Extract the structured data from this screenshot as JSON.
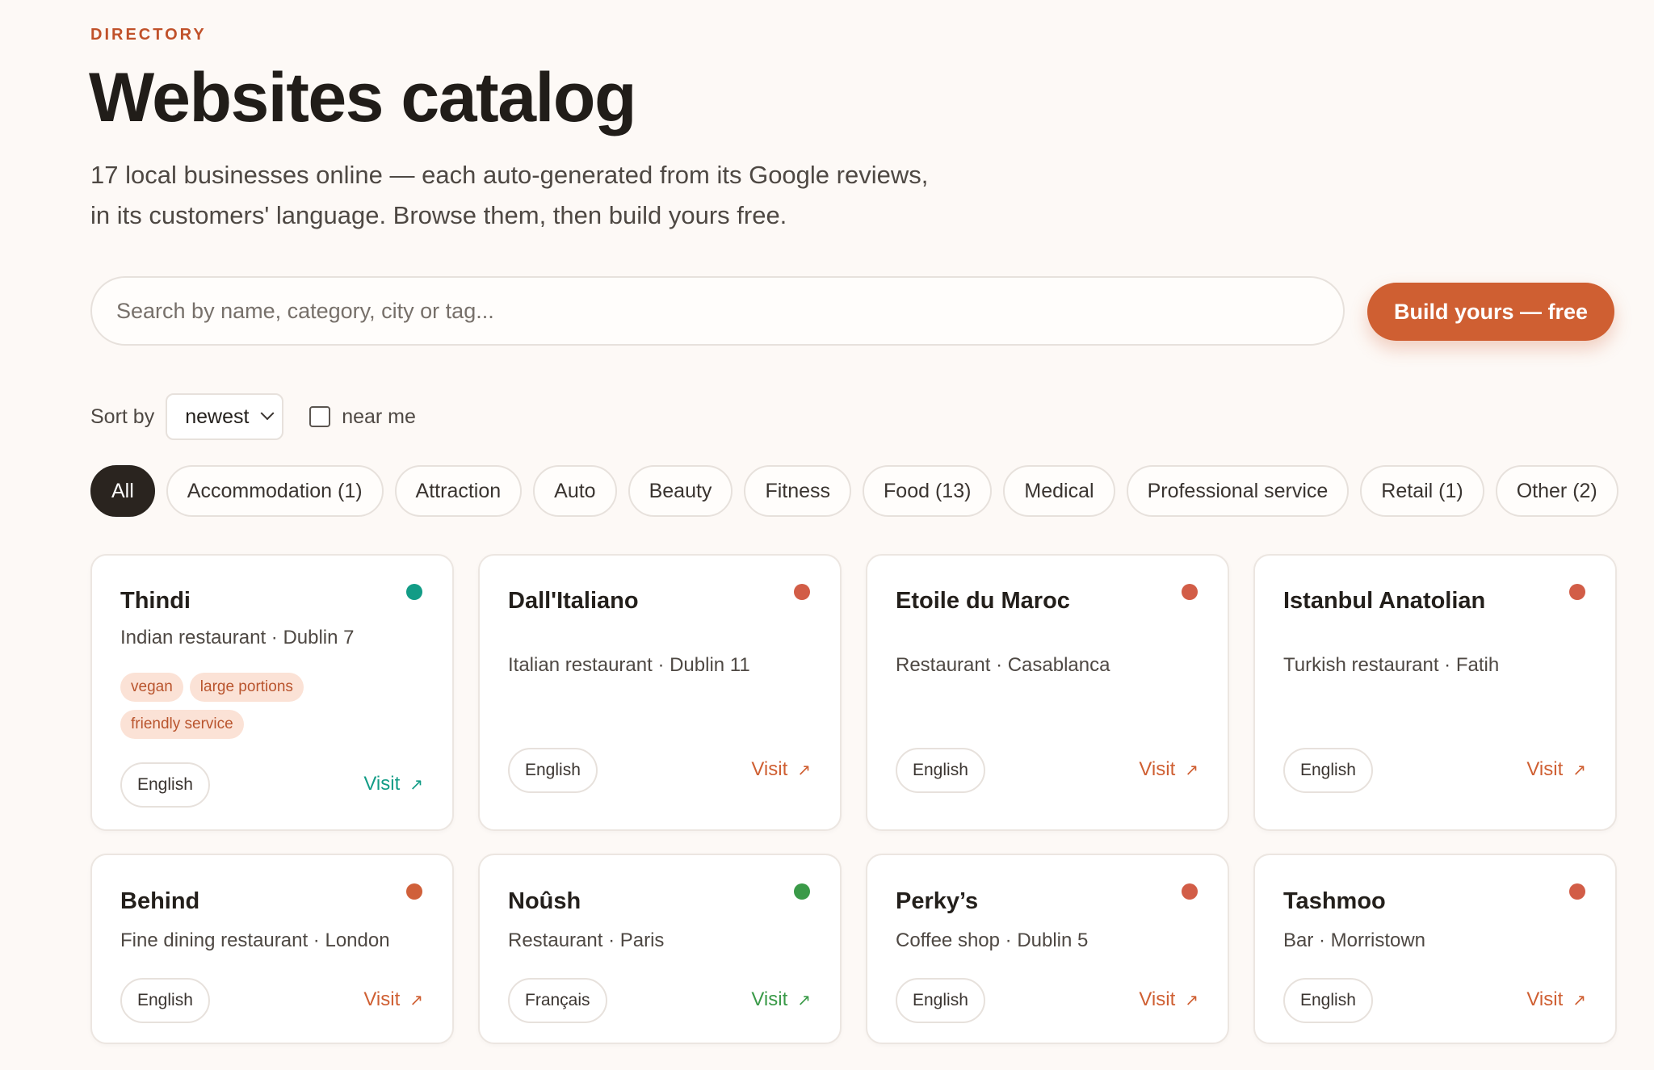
{
  "header": {
    "eyebrow": "DIRECTORY",
    "title": "Websites catalog",
    "subtitle_line1": "17 local businesses online — each auto-generated from its Google reviews,",
    "subtitle_line2": "in its customers' language. Browse them, then build yours free."
  },
  "search": {
    "placeholder": "Search by name, category, city or tag...",
    "value": ""
  },
  "cta": {
    "label": "Build yours — free",
    "color": "#cf5f32"
  },
  "sort": {
    "label": "Sort by",
    "selected": "newest",
    "near_me_label": "near me",
    "near_me_checked": false
  },
  "filters": [
    {
      "label": "All",
      "active": true
    },
    {
      "label": "Accommodation (1)"
    },
    {
      "label": "Attraction"
    },
    {
      "label": "Auto"
    },
    {
      "label": "Beauty"
    },
    {
      "label": "Fitness"
    },
    {
      "label": "Food (13)"
    },
    {
      "label": "Medical"
    },
    {
      "label": "Professional service"
    },
    {
      "label": "Retail (1)"
    },
    {
      "label": "Other (2)"
    }
  ],
  "colors": {
    "accent_orange": "#cf5f32",
    "teal": "#129c86",
    "green": "#3a9a48",
    "red": "#d25d47"
  },
  "cards": [
    {
      "name": "Thindi",
      "meta": "Indian restaurant · Dublin 7",
      "tags": [
        "vegan",
        "large portions",
        "friendly service"
      ],
      "language": "English",
      "visit": "Visit",
      "status_color": "#129c86"
    },
    {
      "name": "Dall'Italiano",
      "meta": "Italian restaurant · Dublin 11",
      "tags": [],
      "language": "English",
      "visit": "Visit",
      "status_color": "#d25d47"
    },
    {
      "name": "Etoile du Maroc",
      "meta": "Restaurant · Casablanca",
      "tags": [],
      "language": "English",
      "visit": "Visit",
      "status_color": "#d25d47"
    },
    {
      "name": "Istanbul Anatolian",
      "meta": "Turkish restaurant · Fatih",
      "tags": [],
      "language": "English",
      "visit": "Visit",
      "status_color": "#d25d47"
    },
    {
      "name": "Behind",
      "meta": "Fine dining restaurant · London",
      "tags": [],
      "language": "English",
      "visit": "Visit",
      "status_color": "#d0603a"
    },
    {
      "name": "Noûsh",
      "meta": "Restaurant · Paris",
      "tags": [],
      "language": "Français",
      "visit": "Visit",
      "status_color": "#3a9a48"
    },
    {
      "name": "Perky’s",
      "meta": "Coffee shop · Dublin 5",
      "tags": [],
      "language": "English",
      "visit": "Visit",
      "status_color": "#d25d47"
    },
    {
      "name": "Tashmoo",
      "meta": "Bar · Morristown",
      "tags": [],
      "language": "English",
      "visit": "Visit",
      "status_color": "#d25d47"
    }
  ]
}
